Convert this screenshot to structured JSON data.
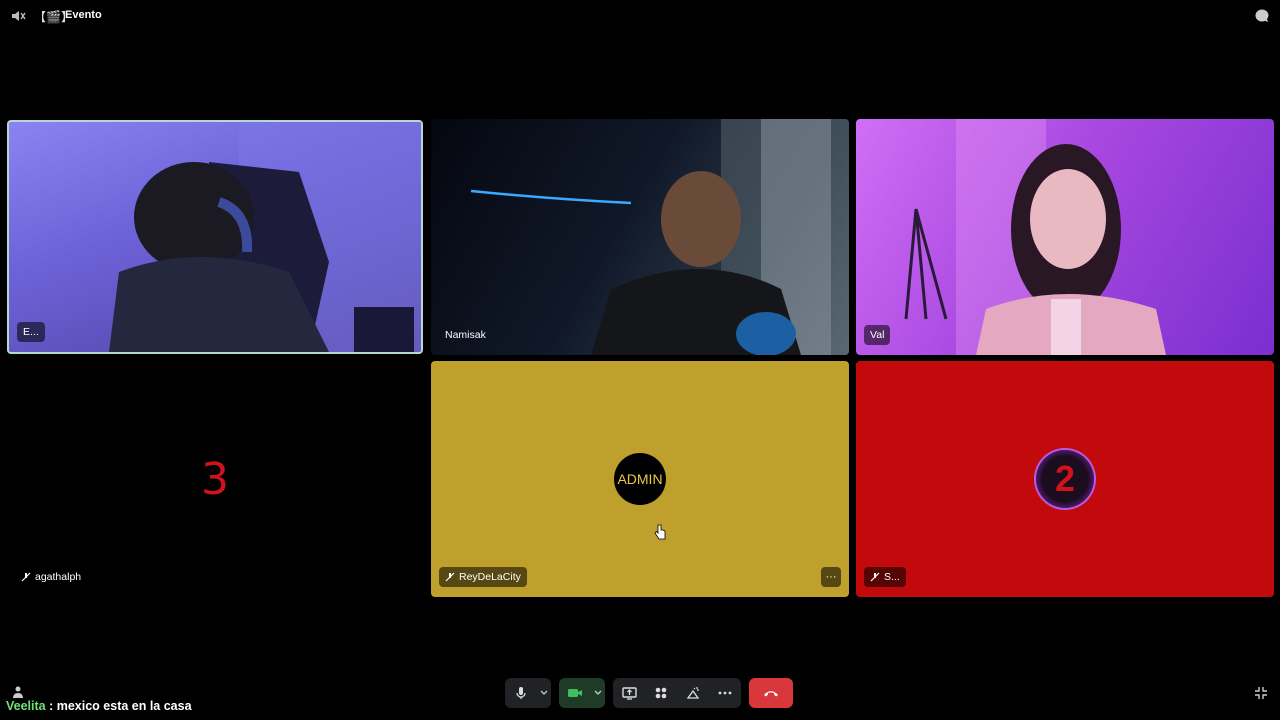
{
  "header": {
    "channel_glyph": "【🎬】",
    "title": "Evento"
  },
  "tiles": [
    {
      "name": "E...",
      "type": "video"
    },
    {
      "name": "Namisak",
      "type": "video"
    },
    {
      "name": "Val",
      "type": "video"
    },
    {
      "name": "agathalph",
      "type": "avatar",
      "avatar_text": "3",
      "muted": true
    },
    {
      "name": "ReyDeLaCity",
      "type": "avatar",
      "avatar_text": "ADMIN",
      "muted": true,
      "background": "#c0a02c"
    },
    {
      "name": "S...",
      "type": "avatar",
      "avatar_text": "2",
      "muted": true,
      "background": "#c2090c"
    }
  ],
  "tile_menu_label": "···",
  "chat": {
    "user": "Veelita",
    "separator": " : ",
    "message": "mexico esta en la casa"
  },
  "controls": {
    "buttons": [
      "microphone-icon",
      "chevron-down-icon",
      "camera-icon",
      "chevron-down-icon",
      "screen-share-icon",
      "activities-icon",
      "soundboard-icon",
      "more-icon",
      "hang-up-icon"
    ]
  },
  "colors": {
    "hangup": "#da373c",
    "chat_user": "#6ee07a",
    "selected_border": "#b7d7d2"
  }
}
